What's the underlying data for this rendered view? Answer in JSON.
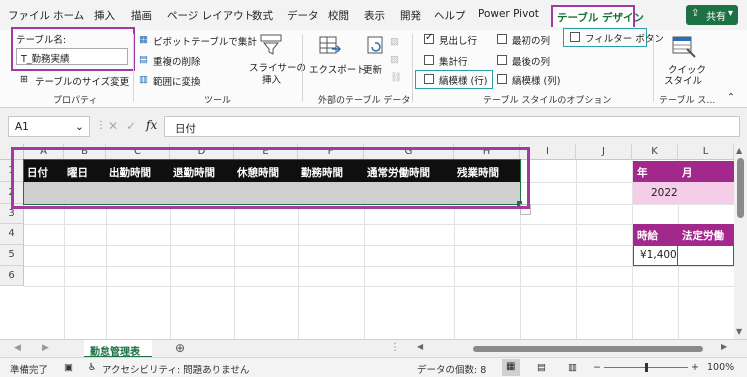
{
  "menu": {
    "items": [
      "ファイル",
      "ホーム",
      "挿入",
      "描画",
      "ページ レイアウト",
      "数式",
      "データ",
      "校閲",
      "表示",
      "開発",
      "ヘルプ",
      "Power Pivot"
    ],
    "active_tab": "テーブル デザイン",
    "share_label": "共有",
    "share_caret": "▾"
  },
  "ribbon": {
    "properties": {
      "table_name_label": "テーブル名:",
      "table_name_value": "T_勤務実績",
      "resize_label": "テーブルのサイズ変更",
      "group_label": "プロパティ"
    },
    "tools": {
      "pivot_label": "ピボットテーブルで集計",
      "dedupe_label": "重複の削除",
      "convert_label": "範囲に変換",
      "slicer_label_1": "スライサーの",
      "slicer_label_2": "挿入",
      "group_label": "ツール"
    },
    "external": {
      "export_label": "エクスポート",
      "refresh_label": "更新",
      "group_label": "外部のテーブル データ"
    },
    "style_options": {
      "header_row": "見出し行",
      "total_row": "集計行",
      "banded_rows": "縞模様 (行)",
      "first_column": "最初の列",
      "last_column": "最後の列",
      "banded_columns": "縞模様 (列)",
      "filter_button": "フィルター ボタン",
      "group_label": "テーブル スタイルのオプション"
    },
    "styles": {
      "quick_label_1": "クイック",
      "quick_label_2": "スタイル",
      "group_label": "テーブル ス…"
    }
  },
  "formula_bar": {
    "cell_ref": "A1",
    "fx": "fx",
    "content": "日付"
  },
  "grid": {
    "columns": [
      "A",
      "B",
      "C",
      "D",
      "E",
      "F",
      "G",
      "H",
      "I",
      "J",
      "K",
      "L"
    ],
    "rows": [
      "1",
      "2",
      "3",
      "4",
      "5",
      "6"
    ],
    "table_headers": [
      "日付",
      "曜日",
      "出勤時間",
      "退勤時間",
      "休憩時間",
      "勤務時間",
      "通常労働時間",
      "残業時間"
    ],
    "side_labels": {
      "year": "年",
      "month": "月",
      "year_value": "2022",
      "hourly_label": "時給",
      "legal_label": "法定労働",
      "hourly_value": "¥1,400"
    }
  },
  "sheet_tabs": {
    "active": "勤怠管理表"
  },
  "status": {
    "ready": "準備完了",
    "accessibility": "アクセシビリティ: 問題ありません",
    "count": "データの個数: 8",
    "zoom": "100%"
  },
  "colors": {
    "highlight": "#a33aa3",
    "header_bg": "#0f0f0f",
    "row_bg": "#cfcfcf",
    "k_header": "#a3288c",
    "k_value_bg": "#f5cde9",
    "excel_green": "#1e7145"
  }
}
